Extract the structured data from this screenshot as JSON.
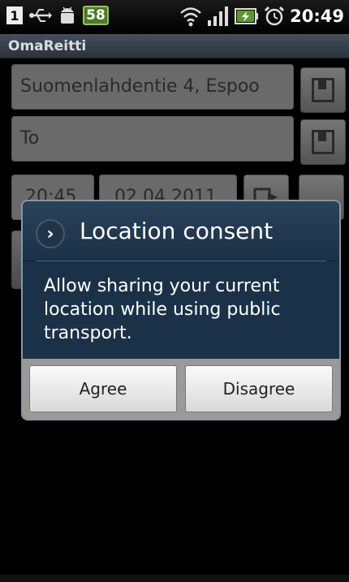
{
  "status": {
    "sim_label": "1",
    "battery_badge": "58",
    "time": "20:49"
  },
  "app": {
    "title": "OmaReitti"
  },
  "form": {
    "from_value": "Suomenlahdentie 4, Espoo",
    "to_placeholder": "To",
    "time_value": "20:45",
    "date_value": "02.04.2011"
  },
  "dialog": {
    "title": "Location consent",
    "message": "Allow sharing your current location while using public transport.",
    "agree_label": "Agree",
    "disagree_label": "Disagree"
  }
}
